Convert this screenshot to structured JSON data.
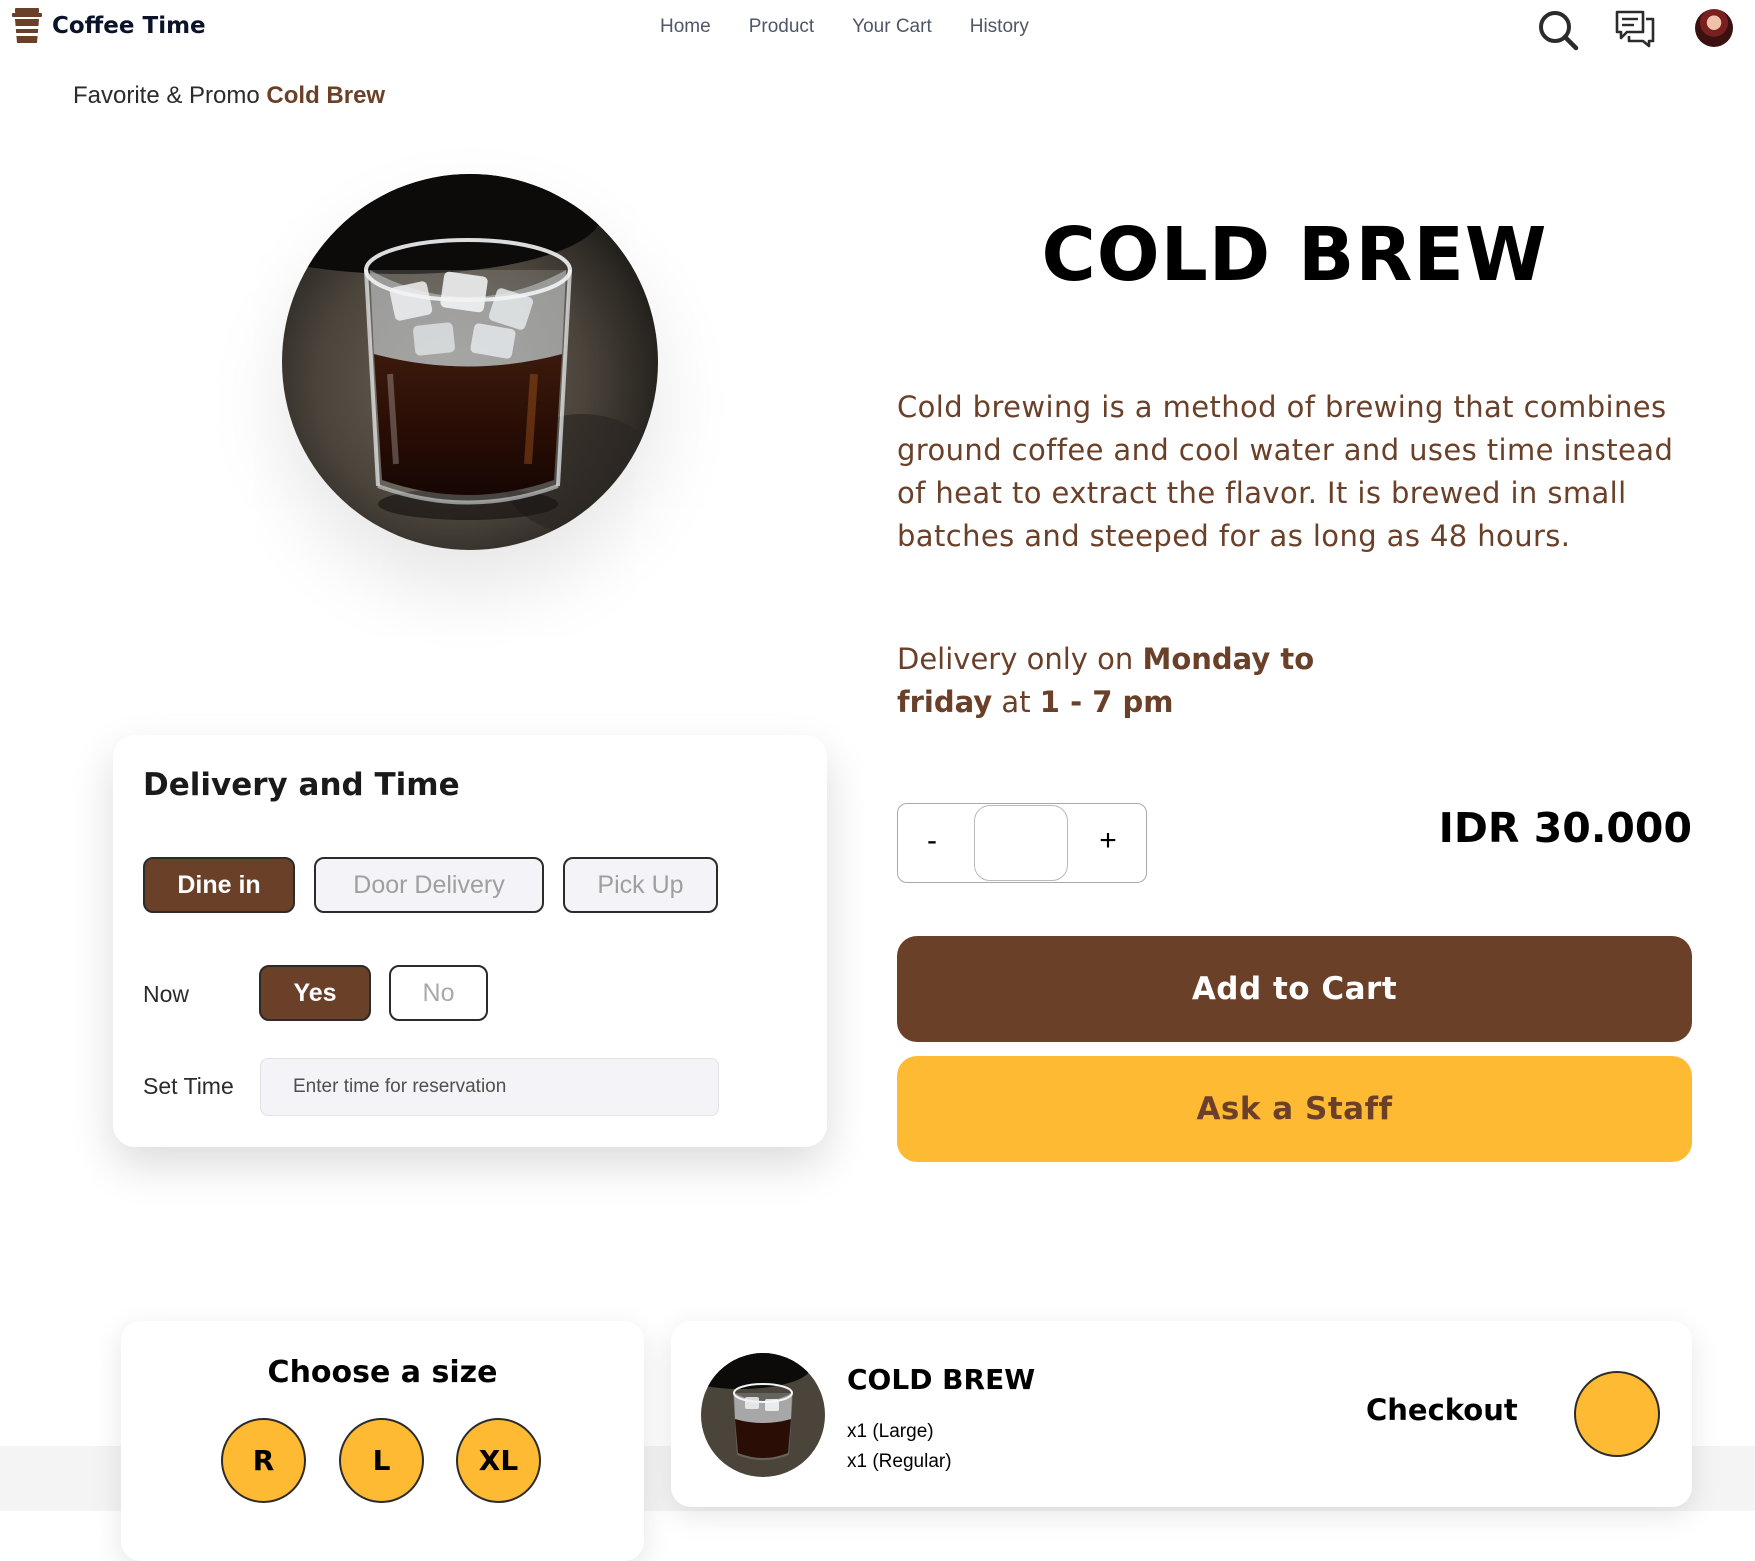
{
  "brand": {
    "name": "Coffee Time",
    "logo_icon": "coffee-cup-icon"
  },
  "nav": {
    "links": [
      "Home",
      "Product",
      "Your Cart",
      "History"
    ],
    "icons": [
      "search-icon",
      "chat-icon",
      "avatar"
    ]
  },
  "breadcrumb": {
    "prefix": "Favorite & Promo",
    "current": "Cold Brew"
  },
  "product": {
    "title": "COLD BREW",
    "description": "Cold brewing is a method of brewing that combines ground coffee and cool water and uses time instead of heat to extract the flavor. It is brewed in small batches and steeped for as long as 48 hours.",
    "delivery_note": {
      "prefix": "Delivery only on",
      "days": "Monday to friday",
      "at": "at",
      "time": "1 - 7 pm"
    },
    "price": "IDR 30.000"
  },
  "delivery_card": {
    "title": "Delivery and Time",
    "methods": [
      {
        "label": "Dine in",
        "selected": true
      },
      {
        "label": "Door Delivery",
        "selected": false
      },
      {
        "label": "Pick Up",
        "selected": false
      }
    ],
    "now_label": "Now",
    "now_options": [
      {
        "label": "Yes",
        "selected": true
      },
      {
        "label": "No",
        "selected": false
      }
    ],
    "set_time_label": "Set Time",
    "set_time_placeholder": "Enter time for reservation",
    "set_time_value": ""
  },
  "quantity": {
    "minus": "-",
    "plus": "+",
    "value": ""
  },
  "buttons": {
    "add_to_cart": "Add to Cart",
    "ask_staff": "Ask a Staff"
  },
  "size_card": {
    "title": "Choose a size",
    "sizes": [
      "R",
      "L",
      "XL"
    ]
  },
  "checkout_card": {
    "name": "COLD BREW",
    "lines": [
      "x1 (Large)",
      "x1 (Regular)"
    ],
    "label": "Checkout"
  },
  "colors": {
    "brown": "#6a4029",
    "yellow": "#ffba33",
    "text_dark": "#0b132a",
    "nav_text": "#4f5665"
  }
}
